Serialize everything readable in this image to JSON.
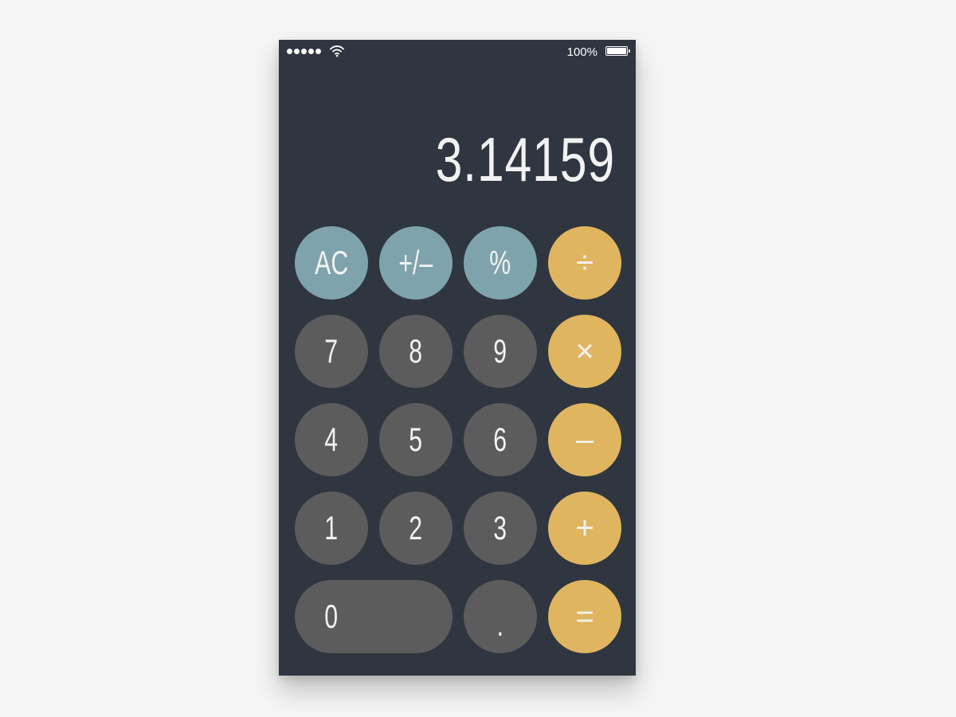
{
  "status_bar": {
    "signal_dots": 5,
    "wifi_icon": "wifi-icon",
    "battery_percent": "100%",
    "battery_level": 1.0
  },
  "display": {
    "value": "3.14159"
  },
  "keys": {
    "ac": "AC",
    "plus_minus": "+/–",
    "percent": "%",
    "divide": "÷",
    "seven": "7",
    "eight": "8",
    "nine": "9",
    "multiply": "×",
    "four": "4",
    "five": "5",
    "six": "6",
    "minus": "–",
    "one": "1",
    "two": "2",
    "three": "3",
    "plus": "+",
    "zero": "0",
    "decimal": ".",
    "equals": "="
  },
  "colors": {
    "background": "#2f3640",
    "function_key": "#7fa3ad",
    "number_key": "#5c5c5c",
    "operator_key": "#e0b560",
    "text": "#f2f2f2"
  }
}
